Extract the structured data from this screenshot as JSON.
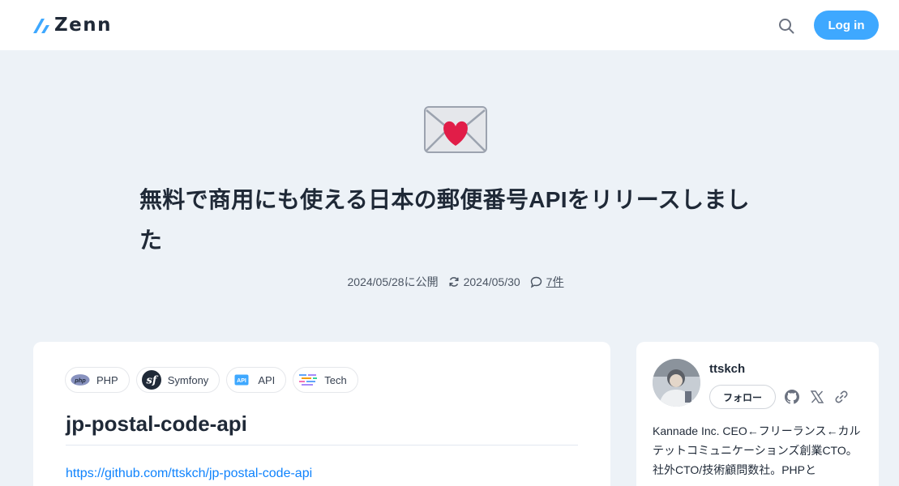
{
  "header": {
    "logo_text": "Zenn",
    "login_label": "Log in",
    "search_icon": "search-icon",
    "brand_color": "#3ea8ff"
  },
  "article": {
    "emoji": "love-letter",
    "title": "無料で商用にも使える日本の郵便番号APIをリリースしました",
    "published": "2024/05/28に公開",
    "updated": "2024/05/30",
    "comments": "7件"
  },
  "tags": [
    {
      "icon": "php-icon",
      "label": "PHP"
    },
    {
      "icon": "symfony-icon",
      "label": "Symfony"
    },
    {
      "icon": "api-icon",
      "label": "API"
    },
    {
      "icon": "tech-icon",
      "label": "Tech"
    }
  ],
  "content": {
    "heading": "jp-postal-code-api",
    "link": "https://github.com/ttskch/jp-postal-code-api"
  },
  "author": {
    "name": "ttskch",
    "follow_label": "フォロー",
    "social_icons": [
      "github-icon",
      "x-icon",
      "link-icon"
    ],
    "bio": "Kannade Inc. CEO←フリーランス←カルテットコミュニケーションズ創業CTO。社外CTO/技術顧問数社。PHPと"
  },
  "colors": {
    "page_bg": "#edf2f7",
    "link": "#0f83fd"
  }
}
